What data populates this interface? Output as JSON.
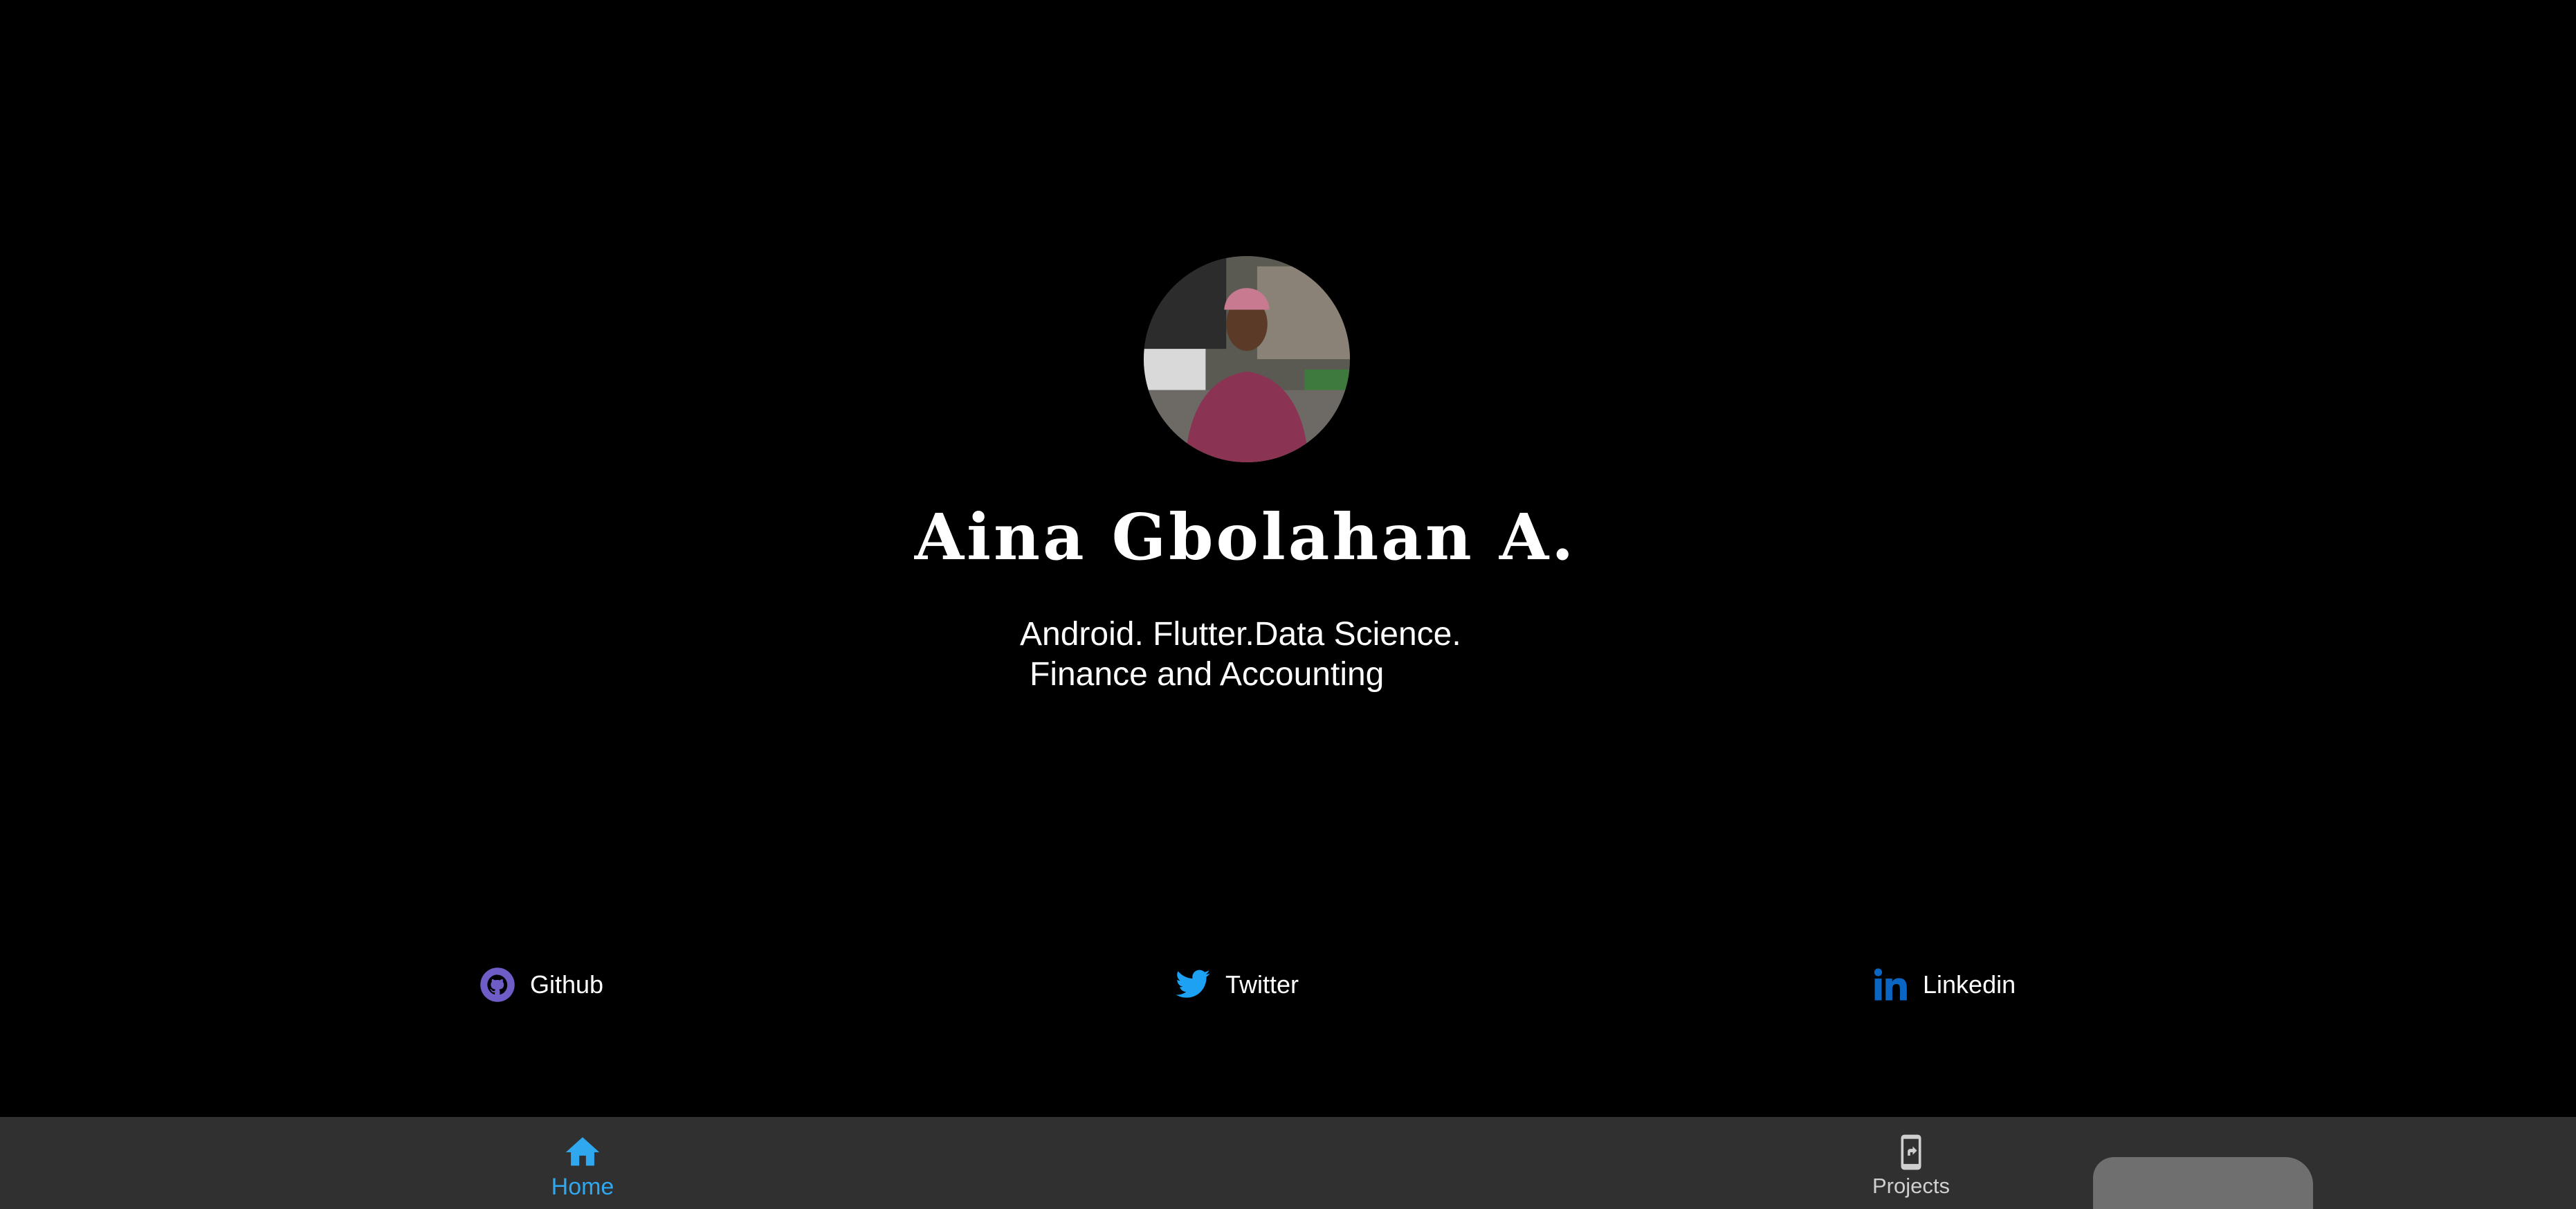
{
  "profile": {
    "name": "Aina Gbolahan A.",
    "tagline_line1": "Android. Flutter.Data Science.",
    "tagline_line2": "Finance and Accounting"
  },
  "social": [
    {
      "label": "Github",
      "icon": "github-icon"
    },
    {
      "label": "Twitter",
      "icon": "twitter-icon"
    },
    {
      "label": "Linkedin",
      "icon": "linkedin-icon"
    }
  ],
  "bottom_nav": {
    "items": [
      {
        "label": "Home",
        "icon": "home-icon",
        "active": true
      },
      {
        "label": "Projects",
        "icon": "projects-icon",
        "active": false
      }
    ]
  },
  "colors": {
    "background": "#000000",
    "nav_background": "#303030",
    "active": "#2fa8f0",
    "github": "#6e5dc6",
    "twitter": "#1da1f2",
    "linkedin": "#0a66c2"
  }
}
